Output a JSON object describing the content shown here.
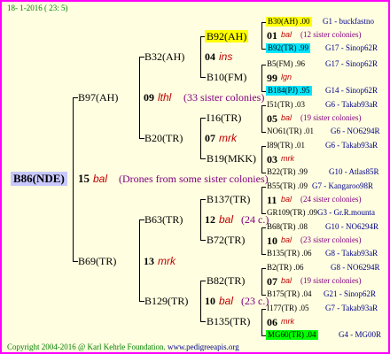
{
  "header": {
    "date": "18- 1-2016 ( 23: 5)"
  },
  "footer": {
    "copyright": "Copyright 2004-2016 @ Karl Kehrle Foundation.",
    "site": "www.pedigreeapis.org"
  },
  "colors": {
    "border": "#ff00ff",
    "background": "#fffee0",
    "highlight_yellow": "#ffff00",
    "highlight_cyan": "#00e5ff",
    "highlight_green": "#00ff00",
    "root_bg": "#c8c8ff"
  },
  "root": {
    "name": "B86(NDE)",
    "num": "15",
    "tag": "bal",
    "note": "(Drones from some sister colonies)"
  },
  "gen1": {
    "top": {
      "name": "B97(AH)",
      "num": "09",
      "tag": "lthl",
      "note": "(33 sister colonies)"
    },
    "bottom": {
      "name": "B69(TR)",
      "num": "13",
      "tag": "mrk"
    }
  },
  "gen2": {
    "a": {
      "name": "B32(AH)",
      "num": "04",
      "tag": "ins"
    },
    "b": {
      "name": "B20(TR)",
      "num": "07",
      "tag": "mrk"
    },
    "c": {
      "name": "B63(TR)",
      "num": "12",
      "tag": "bal",
      "note": "(24 c.)"
    },
    "d": {
      "name": "B129(TR)",
      "num": "10",
      "tag": "bal",
      "note": "(23 c.)"
    }
  },
  "gen3": {
    "a1": {
      "name": "B92(AH)"
    },
    "a2": {
      "name": "B10(FM)"
    },
    "b1": {
      "name": "I16(TR)"
    },
    "b2": {
      "name": "B19(MKK)"
    },
    "c1": {
      "name": "B137(TR)"
    },
    "c2": {
      "name": "B72(TR)"
    },
    "d1": {
      "name": "B82(TR)"
    },
    "d2": {
      "name": "B135(TR)"
    }
  },
  "gen4": [
    {
      "l1": "B30(AH) .00",
      "l1_right": "G1 - buckfastno",
      "mid_num": "01",
      "mid_tag": "bal",
      "mid_note": "(12 sister colonies)",
      "l2": "B92(TR) .99",
      "l2_right": "G17 - Sinop62R"
    },
    {
      "l1": "B5(FM) .96",
      "l1_right": "G17 - Sinop62R",
      "mid_num": "99",
      "mid_tag": "lgn",
      "mid_note": "",
      "l2": "B184(PJ) .95",
      "l2_right": "G14 - Sinop62R"
    },
    {
      "l1": "I51(TR) .03",
      "l1_right": "G6 - Takab93aR",
      "mid_num": "05",
      "mid_tag": "bal",
      "mid_note": "(19 sister colonies)",
      "l2": "NO61(TR) .01",
      "l2_right": "G6 - NO6294R"
    },
    {
      "l1": "I89(TR) .01",
      "l1_right": "G6 - Takab93aR",
      "mid_num": "03",
      "mid_tag": "mrk",
      "mid_note": "",
      "l2": "B22(TR) .99",
      "l2_right": "G10 - Atlas85R"
    },
    {
      "l1": "B55(TR) .09",
      "l1_right": "G7 - Kangaroo98R",
      "mid_num": "11",
      "mid_tag": "bal",
      "mid_note": "(24 sister colonies)",
      "l2": "GR109(TR) .09",
      "l2_right": "G3 - Gr.R.mounta"
    },
    {
      "l1": "B68(TR) .08",
      "l1_right": "G10 - NO6294R",
      "mid_num": "10",
      "mid_tag": "bal",
      "mid_note": "(23 sister colonies)",
      "l2": "B135(TR) .06",
      "l2_right": "G8 - Takab93aR"
    },
    {
      "l1": "B2(TR) .06",
      "l1_right": "G8 - NO6294R",
      "mid_num": "07",
      "mid_tag": "bal",
      "mid_note": "(19 sister colonies)",
      "l2": "B175(TR) .04",
      "l2_right": "G21 - Sinop62R"
    },
    {
      "l1": "I177(TR) .05",
      "l1_right": "G7 - Takab93aR",
      "mid_num": "06",
      "mid_tag": "mrk",
      "mid_note": "",
      "l2": "MG60(TR) .04",
      "l2_right": "G4 - MG00R"
    }
  ]
}
